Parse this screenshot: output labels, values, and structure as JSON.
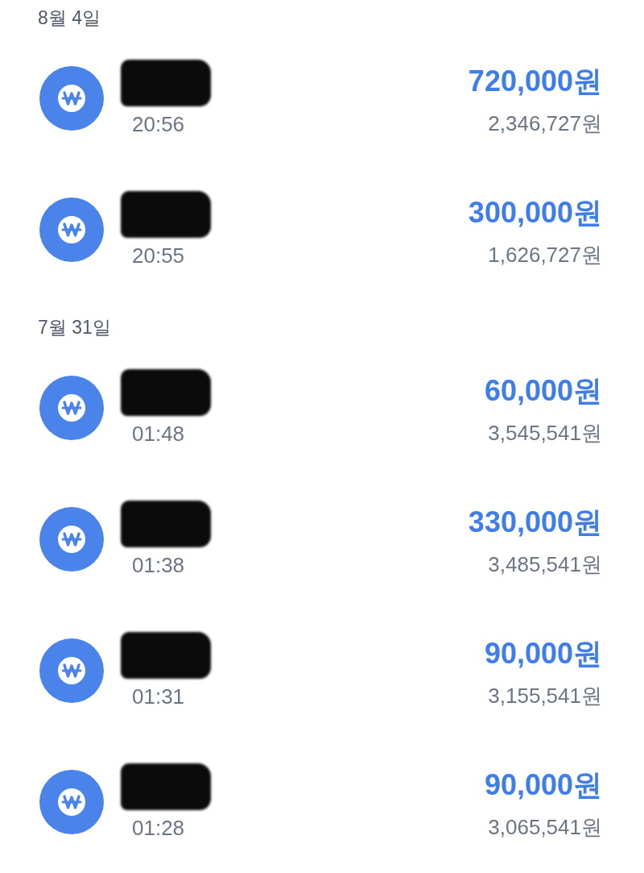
{
  "groups": [
    {
      "date": "8월 4일",
      "transactions": [
        {
          "name_hidden": true,
          "time": "20:56",
          "amount": "720,000원",
          "balance": "2,346,727원"
        },
        {
          "name_hidden": true,
          "time": "20:55",
          "amount": "300,000원",
          "balance": "1,626,727원"
        }
      ]
    },
    {
      "date": "7월 31일",
      "transactions": [
        {
          "name_hidden": true,
          "time": "01:48",
          "amount": "60,000원",
          "balance": "3,545,541원"
        },
        {
          "name_hidden": true,
          "time": "01:38",
          "amount": "330,000원",
          "balance": "3,485,541원"
        },
        {
          "name_hidden": true,
          "time": "01:31",
          "amount": "90,000원",
          "balance": "3,155,541원"
        },
        {
          "name_hidden": true,
          "time": "01:28",
          "amount": "90,000원",
          "balance": "3,065,541원"
        }
      ]
    }
  ]
}
